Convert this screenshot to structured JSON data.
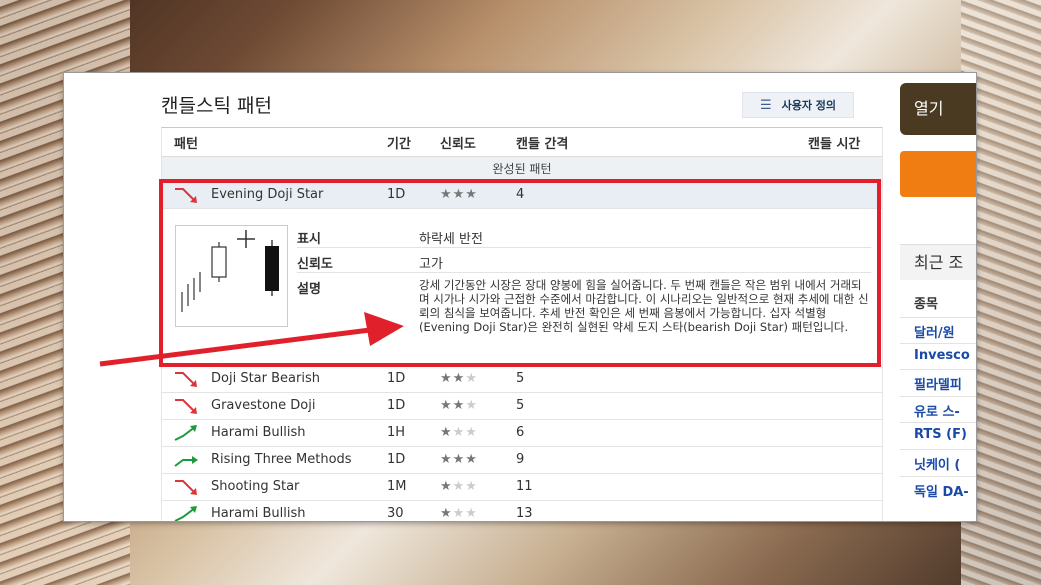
{
  "page": {
    "title": "캔들스틱 패턴",
    "custom_button": "사용자 정의"
  },
  "table": {
    "headers": {
      "pattern": "패턴",
      "period": "기간",
      "reliability": "신뢰도",
      "interval": "캔들 간격",
      "time": "캔들 시간"
    },
    "section": "완성된 패턴",
    "selected": {
      "name": "Evening Doji Star",
      "period": "1D",
      "stars": "★★★",
      "interval": "4",
      "direction": "bearish"
    },
    "detail": {
      "display_label": "표시",
      "display_value": "하락세 반전",
      "reliability_label": "신뢰도",
      "reliability_value": "고가",
      "description_label": "설명",
      "description": "강세 기간동안 시장은 장대 양봉에 힘을 실어줍니다. 두 번째 캔들은 작은 범위 내에서 거래되며 시가나 시가와 근접한 수준에서 마감합니다. 이 시나리오는 일반적으로 현재 추세에 대한 신뢰의 침식을 보여줍니다. 추세 반전 확인은 세 번째 음봉에서 가능합니다. 십자 석별형(Evening Doji Star)은 완전히 실현된 약세 도지 스타(bearish Doji Star) 패턴입니다."
    },
    "rows": [
      {
        "name": "Doji Star Bearish",
        "period": "1D",
        "stars_on": "★★",
        "stars_off": "★",
        "interval": "5",
        "direction": "bearish"
      },
      {
        "name": "Gravestone Doji",
        "period": "1D",
        "stars_on": "★★",
        "stars_off": "★",
        "interval": "5",
        "direction": "bearish"
      },
      {
        "name": "Harami Bullish",
        "period": "1H",
        "stars_on": "★",
        "stars_off": "★★",
        "interval": "6",
        "direction": "bullish"
      },
      {
        "name": "Rising Three Methods",
        "period": "1D",
        "stars_on": "★★★",
        "stars_off": "",
        "interval": "9",
        "direction": "bullish-flat"
      },
      {
        "name": "Shooting Star",
        "period": "1M",
        "stars_on": "★",
        "stars_off": "★★",
        "interval": "11",
        "direction": "bearish"
      },
      {
        "name": "Harami Bullish",
        "period": "30",
        "stars_on": "★",
        "stars_off": "★★",
        "interval": "13",
        "direction": "bullish"
      }
    ]
  },
  "sidebar": {
    "open_tab": "열기",
    "recent": "최근 조",
    "column": "종목",
    "items": [
      "달러/원",
      "Invesco",
      "필라델피",
      "유로 스-",
      "RTS (F)",
      "닛케이 (",
      "독일 DA-"
    ]
  },
  "colors": {
    "accent_orange": "#f07d12",
    "highlight_red": "#e0202a",
    "bearish": "#d9363e",
    "bullish": "#1f9a3a",
    "star_on": "#777777",
    "star_off": "#cccccc"
  }
}
